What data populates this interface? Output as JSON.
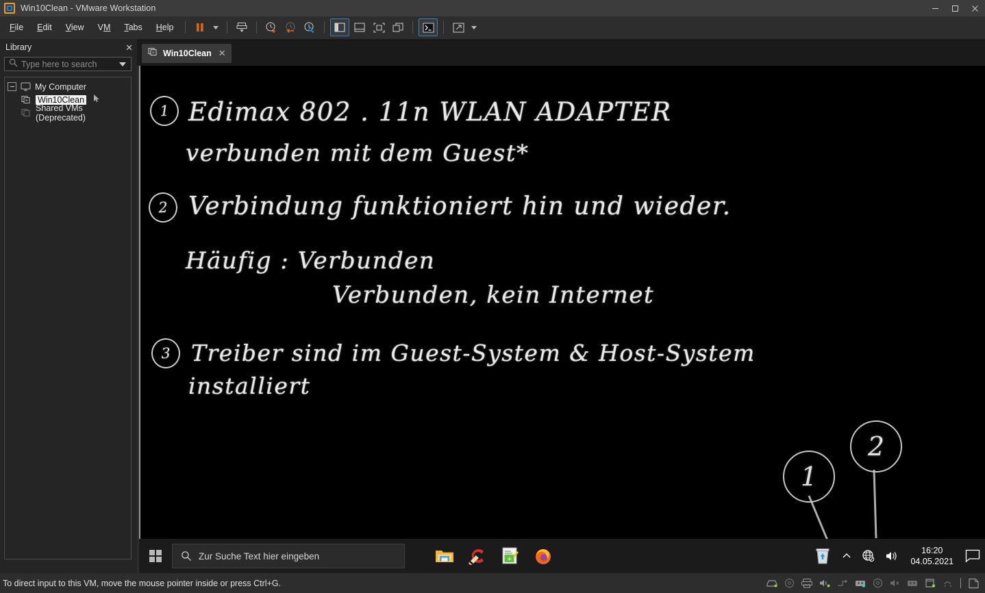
{
  "window": {
    "title": "Win10Clean - VMware Workstation",
    "logo_icon": "vmware-logo-icon",
    "controls": [
      {
        "name": "minimize-button",
        "icon": "minimize-icon"
      },
      {
        "name": "maximize-button",
        "icon": "maximize-icon"
      },
      {
        "name": "close-button",
        "icon": "close-icon"
      }
    ]
  },
  "menubar": {
    "items": [
      {
        "label": "File",
        "mnemonic": "F"
      },
      {
        "label": "Edit",
        "mnemonic": "E"
      },
      {
        "label": "View",
        "mnemonic": "V"
      },
      {
        "label": "VM",
        "mnemonic": "M"
      },
      {
        "label": "Tabs",
        "mnemonic": "T"
      },
      {
        "label": "Help",
        "mnemonic": "H"
      }
    ],
    "toolbar": [
      {
        "name": "suspend-button",
        "icon": "pause-icon"
      },
      {
        "name": "power-dropdown",
        "icon": "chevron-down-icon"
      },
      {
        "name": "snapshot-take-button",
        "icon": "snapshot-icon"
      },
      {
        "name": "snapshot-manager-button",
        "icon": "clock-plus-icon"
      },
      {
        "name": "revert-snapshot-button",
        "icon": "clock-back-icon"
      },
      {
        "name": "manage-snapshots-button",
        "icon": "clock-wrench-icon"
      },
      {
        "name": "show-library-button",
        "icon": "panel-left-icon"
      },
      {
        "name": "show-thumbnails-button",
        "icon": "panel-bottom-icon"
      },
      {
        "name": "fullscreen-button",
        "icon": "fullscreen-icon"
      },
      {
        "name": "unity-mode-button",
        "icon": "windows-stack-icon"
      },
      {
        "name": "console-button",
        "icon": "terminal-icon"
      },
      {
        "name": "stretch-guest-button",
        "icon": "expand-diagonal-icon"
      },
      {
        "name": "stretch-dropdown",
        "icon": "chevron-down-icon"
      }
    ]
  },
  "library": {
    "title": "Library",
    "close_icon": "close-icon",
    "search": {
      "placeholder": "Type here to search",
      "icon": "search-icon",
      "dropdown_icon": "chevron-down-icon"
    },
    "tree": [
      {
        "label": "My Computer",
        "icon": "monitor-icon",
        "level": 1,
        "expanded": true,
        "selected": false
      },
      {
        "label": "Win10Clean",
        "icon": "vm-running-icon",
        "level": 2,
        "expanded": false,
        "selected": true
      },
      {
        "label": "Shared VMs (Deprecated)",
        "icon": "shared-vm-icon",
        "level": 2,
        "expanded": false,
        "selected": false
      }
    ]
  },
  "tabs": [
    {
      "label": "Win10Clean",
      "icon": "vm-running-icon",
      "close_icon": "close-icon",
      "active": true
    }
  ],
  "vm_screen": {
    "background_color": "#000000",
    "handwriting": {
      "notes": [
        {
          "number": "1",
          "lines": [
            "Edimax  802 . 11n  WLAN ADAPTER",
            "verbunden  mit  dem  Guest*"
          ]
        },
        {
          "number": "2",
          "lines": [
            "Verbindung  funktioniert  hin  und wieder.",
            "Häufig :  Verbunden",
            "Verbunden, kein Internet"
          ]
        },
        {
          "number": "3",
          "lines": [
            "Treiber  sind  im  Guest-System  &  Host-System",
            "installiert"
          ]
        }
      ],
      "pointers": [
        {
          "number": "1",
          "target": "network-tray-icon"
        },
        {
          "number": "2",
          "target": "recycle-bin-icon"
        }
      ]
    },
    "taskbar": {
      "start_icon": "windows-start-icon",
      "search": {
        "placeholder": "Zur Suche Text hier eingeben",
        "icon": "search-icon"
      },
      "pinned_apps": [
        {
          "name": "file-explorer-icon",
          "label": "Explorer"
        },
        {
          "name": "ccleaner-icon",
          "label": "CCleaner"
        },
        {
          "name": "notepad-plus-plus-icon",
          "label": "Notepad++"
        },
        {
          "name": "firefox-icon",
          "label": "Firefox"
        }
      ],
      "tray": [
        {
          "name": "recycle-bin-icon"
        },
        {
          "name": "show-hidden-icons-chevron-icon"
        },
        {
          "name": "network-disconnected-icon"
        },
        {
          "name": "volume-icon"
        }
      ],
      "clock": {
        "time": "16:20",
        "date": "04.05.2021"
      },
      "action_center_icon": "action-center-icon"
    }
  },
  "statusbar": {
    "message": "To direct input to this VM, move the mouse pointer inside or press Ctrl+G.",
    "devices": [
      {
        "name": "hard-disk-icon",
        "active": true
      },
      {
        "name": "cd-dvd-icon",
        "active": false
      },
      {
        "name": "printer-icon",
        "active": false
      },
      {
        "name": "sound-icon",
        "active": true
      },
      {
        "name": "network-adapter-icon",
        "active": false
      },
      {
        "name": "usb-device-icon",
        "active": true
      },
      {
        "name": "floppy-icon",
        "active": false
      },
      {
        "name": "audio-input-icon",
        "active": false
      },
      {
        "name": "usb-printer-icon",
        "active": false
      },
      {
        "name": "camera-icon",
        "active": true
      },
      {
        "name": "bluetooth-icon",
        "active": false
      },
      {
        "name": "message-log-icon",
        "active": false
      }
    ]
  },
  "colors": {
    "titlebar": "#3c3c3c",
    "chrome": "#2d2d2d",
    "panel": "#252526",
    "vm_screen": "#000000",
    "accent_orange": "#d9631a",
    "accent_blue": "#4a7fa8",
    "selection": "#f2f2f2"
  }
}
